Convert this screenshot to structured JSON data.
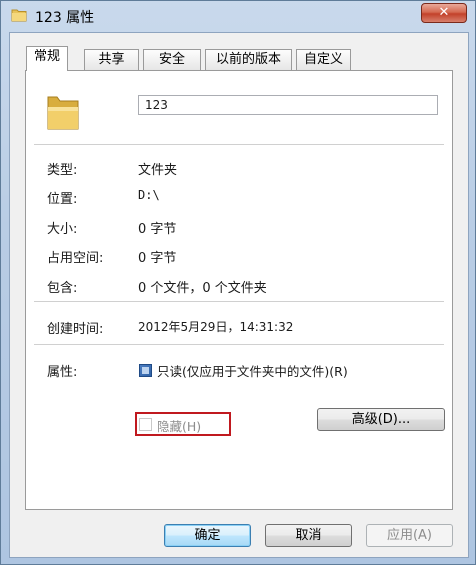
{
  "window": {
    "title": "123 属性",
    "close_label": "✕"
  },
  "tabs": [
    {
      "label": "常规",
      "active": true
    },
    {
      "label": "共享",
      "active": false
    },
    {
      "label": "安全",
      "active": false
    },
    {
      "label": "以前的版本",
      "active": false
    },
    {
      "label": "自定义",
      "active": false
    }
  ],
  "general": {
    "name_value": "123",
    "type_label": "类型:",
    "type_value": "文件夹",
    "location_label": "位置:",
    "location_value": "D:\\",
    "size_label": "大小:",
    "size_value": "0 字节",
    "disk_size_label": "占用空间:",
    "disk_size_value": "0 字节",
    "contains_label": "包含:",
    "contains_value": "0 个文件，0 个文件夹",
    "created_label": "创建时间:",
    "created_value": "2012年5月29日，14:31:32",
    "attributes_label": "属性:",
    "readonly_label": "只读(仅应用于文件夹中的文件)(R)",
    "hidden_label": "隐藏(H)",
    "advanced_label": "高级(D)..."
  },
  "buttons": {
    "ok": "确定",
    "cancel": "取消",
    "apply": "应用(A)"
  },
  "colors": {
    "highlight_box": "#c0191f",
    "title_bar": "#b9cde5",
    "close_button": "#c3412a"
  }
}
